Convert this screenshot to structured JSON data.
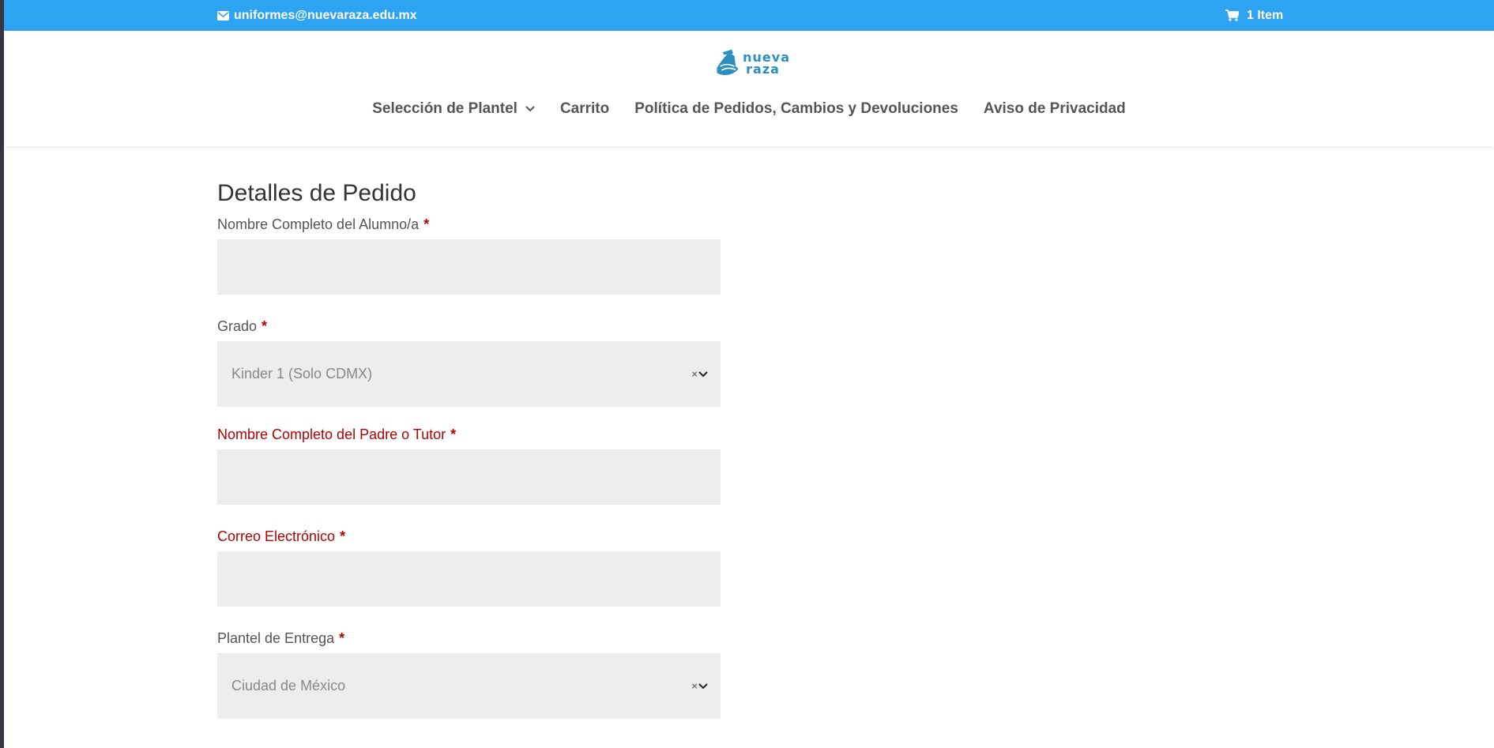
{
  "topbar": {
    "email": "uniformes@nuevaraza.edu.mx",
    "cart_count": "1 Item",
    "color": "#2ea3f2"
  },
  "logo": {
    "line1": "nueva",
    "line2": "raza",
    "icon": "ship-logo-icon"
  },
  "nav": {
    "items": [
      {
        "label": "Selección de Plantel",
        "has_dropdown": true
      },
      {
        "label": "Carrito"
      },
      {
        "label": "Política de Pedidos, Cambios y Devoluciones"
      },
      {
        "label": "Aviso de Privacidad"
      }
    ]
  },
  "form": {
    "title": "Detalles de Pedido",
    "required_mark": "*",
    "fields": [
      {
        "label": "Nombre Completo del Alumno/a",
        "value": ""
      },
      {
        "label": "Grado",
        "value": "Kinder 1 (Solo CDMX)"
      },
      {
        "label": "Nombre Completo del Padre o Tutor",
        "value": ""
      },
      {
        "label": "Correo Electrónico",
        "value": ""
      },
      {
        "label": "Plantel de Entrega",
        "value": "Ciudad de México"
      }
    ],
    "clear_symbol": "×",
    "error_color": "#b30000"
  }
}
